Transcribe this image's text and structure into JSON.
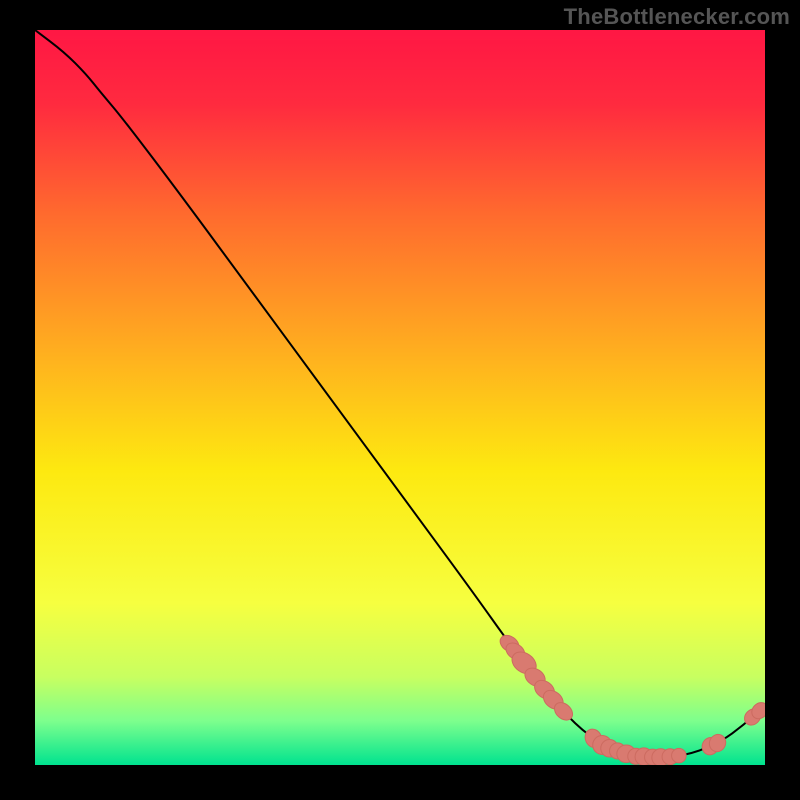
{
  "watermark": "TheBottlenecker.com",
  "chart_data": {
    "type": "line",
    "title": "",
    "xlabel": "",
    "ylabel": "",
    "xlim": [
      0,
      100
    ],
    "ylim": [
      0,
      100
    ],
    "grid": false,
    "gradient_stops": [
      {
        "pos": 0.0,
        "color": "#ff1744"
      },
      {
        "pos": 0.1,
        "color": "#ff2a3f"
      },
      {
        "pos": 0.25,
        "color": "#ff6a2e"
      },
      {
        "pos": 0.45,
        "color": "#ffb31e"
      },
      {
        "pos": 0.6,
        "color": "#fde910"
      },
      {
        "pos": 0.78,
        "color": "#f6ff40"
      },
      {
        "pos": 0.88,
        "color": "#c8ff60"
      },
      {
        "pos": 0.94,
        "color": "#7dff8d"
      },
      {
        "pos": 1.0,
        "color": "#00e38f"
      }
    ],
    "series": [
      {
        "name": "curve",
        "stroke": "#000000",
        "points": [
          {
            "x": 0,
            "y": 100
          },
          {
            "x": 4,
            "y": 97
          },
          {
            "x": 7,
            "y": 94
          },
          {
            "x": 9,
            "y": 91.5
          },
          {
            "x": 12,
            "y": 88
          },
          {
            "x": 20,
            "y": 77.5
          },
          {
            "x": 30,
            "y": 64
          },
          {
            "x": 40,
            "y": 50.5
          },
          {
            "x": 50,
            "y": 37
          },
          {
            "x": 60,
            "y": 23.5
          },
          {
            "x": 65,
            "y": 16.5
          },
          {
            "x": 70,
            "y": 10
          },
          {
            "x": 74,
            "y": 5.5
          },
          {
            "x": 78,
            "y": 2.5
          },
          {
            "x": 82,
            "y": 1.2
          },
          {
            "x": 86,
            "y": 1.0
          },
          {
            "x": 90,
            "y": 1.5
          },
          {
            "x": 94,
            "y": 3.2
          },
          {
            "x": 97,
            "y": 5.4
          },
          {
            "x": 100,
            "y": 8
          }
        ]
      }
    ],
    "markers": {
      "stroke": "#cc6b60",
      "fill": "#d97a70",
      "points": [
        {
          "x": 65.0,
          "r_x": 1.0,
          "r_y": 1.4,
          "rot": -55
        },
        {
          "x": 65.8,
          "r_x": 1.0,
          "r_y": 1.4,
          "rot": -55
        },
        {
          "x": 67.0,
          "r_x": 1.3,
          "r_y": 1.8,
          "rot": -55
        },
        {
          "x": 68.5,
          "r_x": 1.1,
          "r_y": 1.5,
          "rot": -55
        },
        {
          "x": 69.8,
          "r_x": 1.1,
          "r_y": 1.5,
          "rot": -52
        },
        {
          "x": 71.0,
          "r_x": 1.1,
          "r_y": 1.5,
          "rot": -50
        },
        {
          "x": 72.4,
          "r_x": 1.0,
          "r_y": 1.4,
          "rot": -48
        },
        {
          "x": 76.5,
          "r_x": 1.1,
          "r_y": 1.3,
          "rot": -25
        },
        {
          "x": 77.7,
          "r_x": 1.3,
          "r_y": 1.3,
          "rot": -10
        },
        {
          "x": 78.7,
          "r_x": 1.2,
          "r_y": 1.2,
          "rot": 0
        },
        {
          "x": 79.8,
          "r_x": 1.1,
          "r_y": 1.1,
          "rot": 0
        },
        {
          "x": 81.0,
          "r_x": 1.3,
          "r_y": 1.2,
          "rot": 0
        },
        {
          "x": 82.3,
          "r_x": 1.1,
          "r_y": 1.1,
          "rot": 0
        },
        {
          "x": 83.4,
          "r_x": 1.2,
          "r_y": 1.2,
          "rot": 0
        },
        {
          "x": 84.6,
          "r_x": 1.1,
          "r_y": 1.1,
          "rot": 0
        },
        {
          "x": 85.7,
          "r_x": 1.2,
          "r_y": 1.2,
          "rot": 0
        },
        {
          "x": 87.0,
          "r_x": 1.1,
          "r_y": 1.1,
          "rot": 0
        },
        {
          "x": 88.2,
          "r_x": 1.0,
          "r_y": 1.0,
          "rot": 0
        },
        {
          "x": 92.5,
          "r_x": 1.1,
          "r_y": 1.2,
          "rot": 20
        },
        {
          "x": 93.5,
          "r_x": 1.1,
          "r_y": 1.2,
          "rot": 25
        },
        {
          "x": 98.3,
          "r_x": 1.0,
          "r_y": 1.2,
          "rot": 45
        },
        {
          "x": 99.3,
          "r_x": 1.0,
          "r_y": 1.2,
          "rot": 45
        }
      ]
    }
  }
}
